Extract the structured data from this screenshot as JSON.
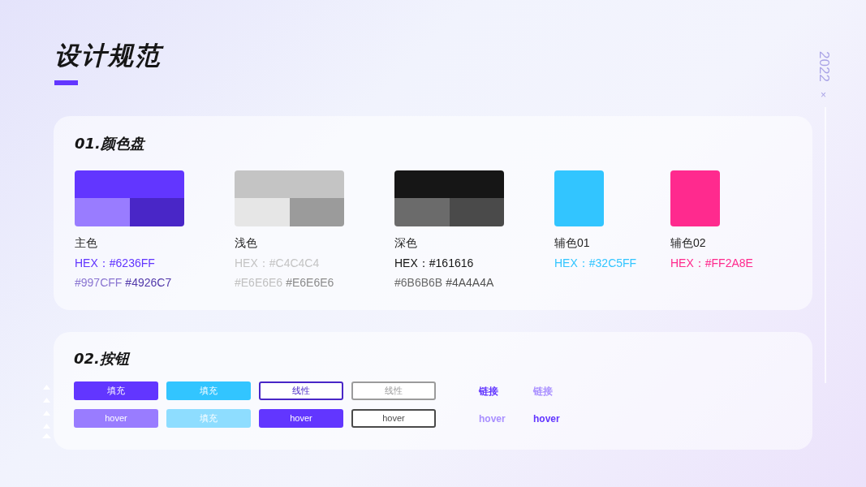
{
  "title": "设计规范",
  "side_label": {
    "year": "2022",
    "mark": "×"
  },
  "palette": {
    "heading": "01.颜色盘",
    "swatches": [
      {
        "kind": "triple",
        "name": "主色",
        "hex": "HEX：#6236FF",
        "color": "#6236FF",
        "shades": [
          {
            "text": "#997CFF",
            "color": "#997CFF"
          },
          {
            "text": "#4926C7",
            "color": "#4926C7"
          }
        ]
      },
      {
        "kind": "triple",
        "name": "浅色",
        "hex": "HEX：#C4C4C4",
        "color": "#C4C4C4",
        "shades": [
          {
            "text": "#E6E6E6",
            "color": "#E6E6E6"
          },
          {
            "text": "#E6E6E6",
            "color": "#9B9B9B"
          }
        ]
      },
      {
        "kind": "triple",
        "name": "深色",
        "hex": "HEX：#161616",
        "color": "#161616",
        "shades": [
          {
            "text": "#6B6B6B",
            "color": "#6B6B6B"
          },
          {
            "text": "#4A4A4A",
            "color": "#4A4A4A"
          }
        ]
      },
      {
        "kind": "single",
        "name": "辅色01",
        "hex": "HEX：#32C5FF",
        "color": "#32C5FF"
      },
      {
        "kind": "single",
        "name": "辅色02",
        "hex": "HEX：#FF2A8E",
        "color": "#FF2A8E"
      }
    ]
  },
  "buttons": {
    "heading": "02.按钮",
    "rows": [
      [
        {
          "kind": "fill",
          "label": "填充",
          "color": "#6236FF"
        },
        {
          "kind": "fill",
          "label": "填充",
          "color": "#32C5FF"
        },
        {
          "kind": "outline",
          "label": "线性",
          "color": "#4926C7"
        },
        {
          "kind": "outline",
          "label": "线性",
          "color": "#9B9B9B"
        },
        {
          "kind": "link",
          "label": "链接",
          "color": "#6236FF"
        },
        {
          "kind": "link",
          "label": "链接",
          "color": "#A98FFF"
        }
      ],
      [
        {
          "kind": "fill",
          "label": "hover",
          "color": "#997CFF"
        },
        {
          "kind": "fill",
          "label": "填充",
          "color": "#8EDDFF"
        },
        {
          "kind": "fill",
          "label": "hover",
          "color": "#6236FF"
        },
        {
          "kind": "outline",
          "label": "hover",
          "color": "#4A4A4A"
        },
        {
          "kind": "link",
          "label": "hover",
          "color": "#A98FFF"
        },
        {
          "kind": "link",
          "label": "hover",
          "color": "#6236FF"
        }
      ]
    ]
  }
}
